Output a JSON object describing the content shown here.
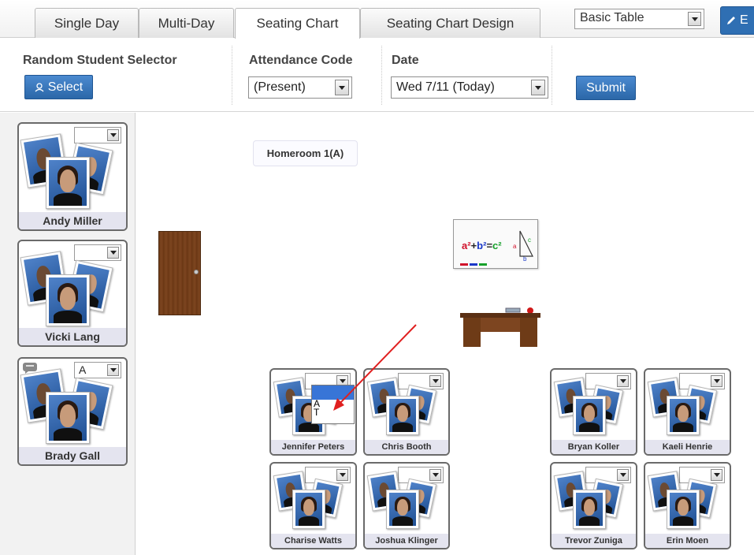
{
  "tabs": [
    {
      "label": "Single Day",
      "active": false
    },
    {
      "label": "Multi-Day",
      "active": false
    },
    {
      "label": "Seating Chart",
      "active": true
    },
    {
      "label": "Seating Chart Design",
      "active": false
    }
  ],
  "view_select": {
    "value": "Basic Table"
  },
  "edit_button": {
    "label": "E"
  },
  "toolbar": {
    "random": {
      "title": "Random Student Selector",
      "button": "Select"
    },
    "attendance": {
      "title": "Attendance Code",
      "value": "(Present)"
    },
    "date": {
      "title": "Date",
      "value": "Wed 7/11 (Today)"
    },
    "submit": "Submit"
  },
  "room_label": "Homeroom 1(A)",
  "left_students": [
    {
      "name": "Andy Miller",
      "code": ""
    },
    {
      "name": "Vicki Lang",
      "code": ""
    },
    {
      "name": "Brady Gall",
      "code": "A"
    }
  ],
  "seated_students": [
    {
      "name": "Jennifer Peters",
      "code": ""
    },
    {
      "name": "Chris Booth",
      "code": ""
    },
    {
      "name": "Bryan Koller",
      "code": ""
    },
    {
      "name": "Kaeli Henrie",
      "code": ""
    },
    {
      "name": "Charise Watts",
      "code": ""
    },
    {
      "name": "Joshua Klinger",
      "code": ""
    },
    {
      "name": "Trevor Zuniga",
      "code": ""
    },
    {
      "name": "Erin Moen",
      "code": ""
    }
  ],
  "code_dropdown_options": [
    "",
    "A",
    "T"
  ],
  "whiteboard": {
    "text": "a²+b²=c²",
    "labels": [
      "a",
      "c",
      "b"
    ]
  },
  "colors": {
    "accent": "#2f6fb3",
    "annotation_arrow": "#e02020"
  }
}
